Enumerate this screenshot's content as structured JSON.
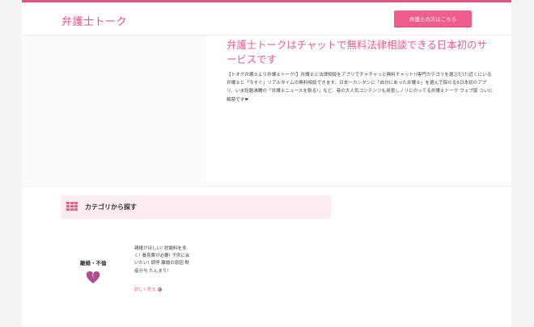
{
  "header": {
    "logo": "弁護士トーク",
    "lawyer_button": "弁護士の方はこちら"
  },
  "hero": {
    "title": "弁護士トークはチャットで無料法律相談できる日本初のサービスです",
    "description": "【トオク弁護士より弁護士トーク!】弁護士と法律相談をアプリでチャチャっと無料チャット!!専門カテゴリを選ぶだけ!近くにいる弁護士と「今すぐ」リアルタイムの無料相談できます。日本一カンタンに「自分にあった弁護士」を選んで探せる5日本初のアプリ、いま話題沸騰の「弁護士ニュースを斬る!」など、巷の大人気コンテンツも用意しノリにのってる弁護士トーク ウェブ版 ついに解禁です❤︎"
  },
  "categories": {
    "title": "カテゴリから探す",
    "grid_icon": "grid-icon",
    "accent_color": "#ec5f8c",
    "items": [
      {
        "label": "離婚・不倫",
        "icon": "broken-heart-icon",
        "icon_color": "#b24a8f",
        "description": "親権がほしい! 慰謝料を多く! 養育費が必要! 子供に会いたい! 調停 離婚の原因 財産分与 たんまり!",
        "more_label": "詳しく見る"
      }
    ]
  }
}
